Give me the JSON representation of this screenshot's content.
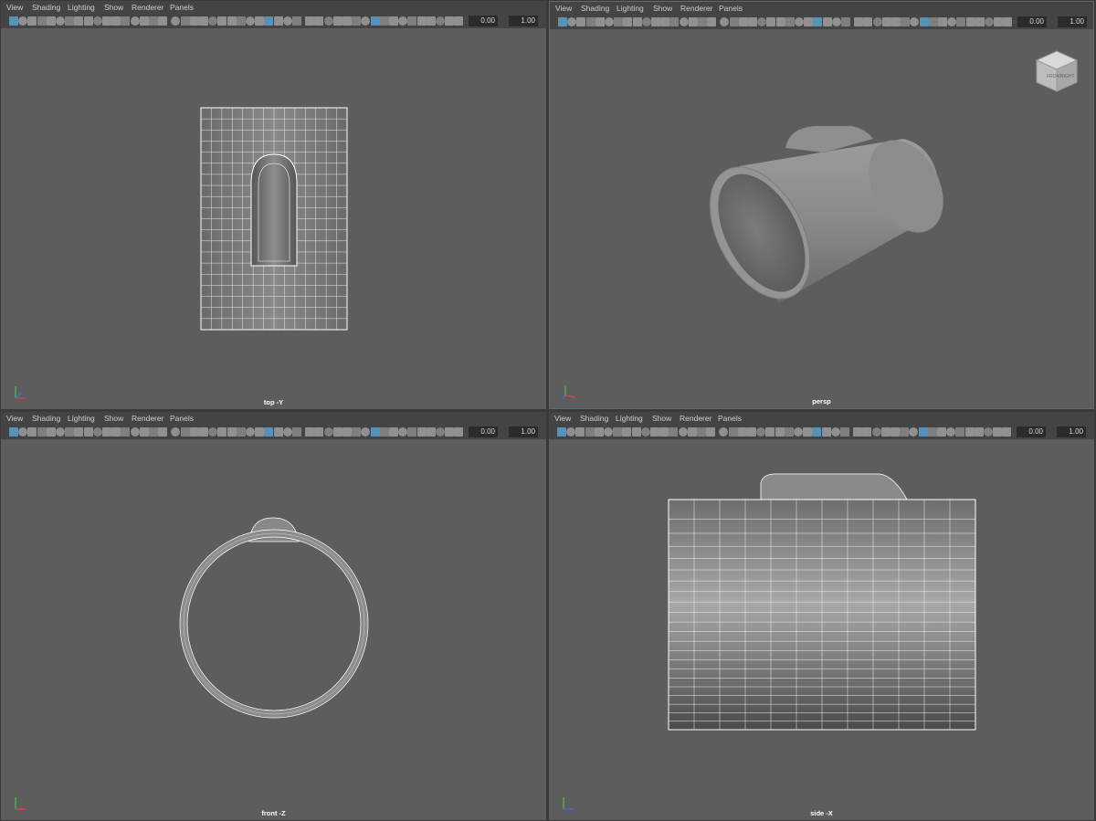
{
  "menus": [
    "View",
    "Shading",
    "Lighting",
    "Show",
    "Renderer",
    "Panels"
  ],
  "toolbar": {
    "field_a": "0.00",
    "field_b": "1.00"
  },
  "panels": [
    {
      "id": "top",
      "label": "top -Y"
    },
    {
      "id": "persp",
      "label": "persp"
    },
    {
      "id": "front",
      "label": "front -Z"
    },
    {
      "id": "side",
      "label": "side -X"
    }
  ],
  "view_cube": {
    "face_front": "FRONT",
    "face_right": "RIGHT"
  },
  "colors": {
    "viewport_bg": "#5d5d5d",
    "toolbar_accent": "#5aa0d0",
    "wire": "#ffffff"
  }
}
